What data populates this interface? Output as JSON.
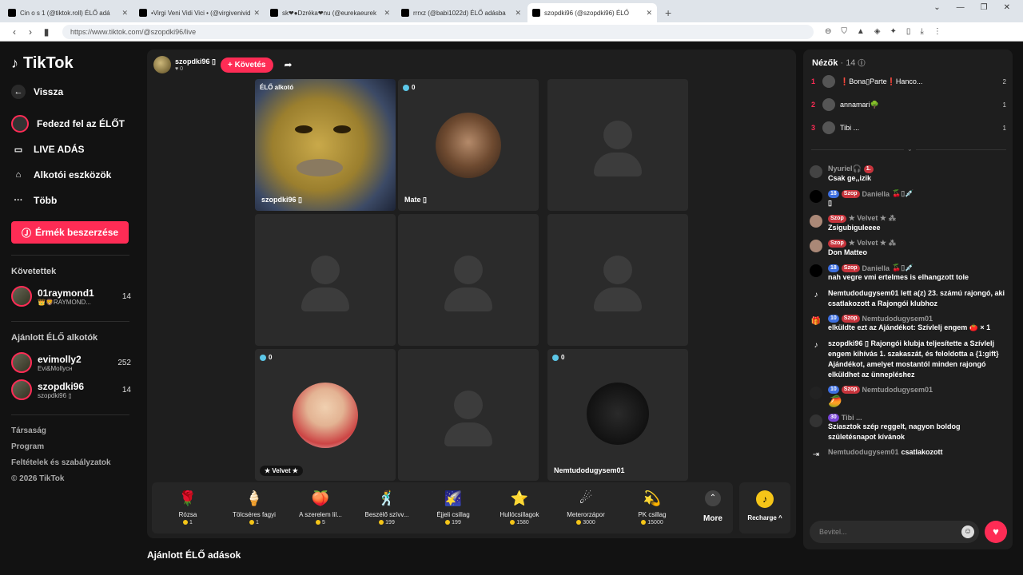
{
  "browser": {
    "tabs": [
      {
        "title": "Cin o s 1 (@tiktok.roll) ÉLŐ adá",
        "active": false
      },
      {
        "title": "•Virgi Veni Vidi Vici • (@virgivenivid",
        "active": false
      },
      {
        "title": "sk❤●Dzréka❤nu (@eurekaeurek",
        "active": false
      },
      {
        "title": "rrrxz (@babi1022d) ÉLŐ adásba",
        "active": false
      },
      {
        "title": "szopdki96 (@szopdki96) ÉLŐ",
        "active": true
      }
    ],
    "url": "https://www.tiktok.com/@szopdki96/live",
    "win_controls": [
      "⌄",
      "—",
      "❐",
      "✕"
    ]
  },
  "sidebar": {
    "brand": "TikTok",
    "back": "Vissza",
    "nav": [
      {
        "label": "Fedezd fel az ÉLŐT",
        "icon": "live-avatar-icon"
      },
      {
        "label": "LIVE ADÁS",
        "icon": "camera-icon"
      },
      {
        "label": "Alkotói eszközök",
        "icon": "home-tools-icon"
      },
      {
        "label": "Több",
        "icon": "more-dots-icon"
      }
    ],
    "coins_button": "Érmék beszerzése",
    "following_title": "Követettek",
    "following": [
      {
        "name": "01raymond1",
        "sub": "👑🦁RAYMOND...",
        "count": "14"
      }
    ],
    "suggested_title": "Ajánlott ÉLŐ alkotók",
    "suggested": [
      {
        "name": "evimolly2",
        "sub": "Evi&Mollyсн",
        "count": "252"
      },
      {
        "name": "szopdki96",
        "sub": "szopdki96 ▯",
        "count": "14"
      }
    ],
    "footer": [
      "Társaság",
      "Program",
      "Feltételek és szabályzatok",
      "© 2026 TikTok"
    ]
  },
  "live": {
    "host_name": "szopdki96 ▯",
    "host_likes": "♥ 0",
    "follow_label": "+ Követés",
    "cells": [
      {
        "label": "szopdki96 ▯",
        "badge": "ÉLŐ alkotó"
      },
      {
        "label": "Mate ▯",
        "badge": "0"
      },
      {
        "label": "",
        "badge": ""
      },
      {
        "label": "",
        "badge": ""
      },
      {
        "label": "",
        "badge": ""
      },
      {
        "label": "",
        "badge": ""
      },
      {
        "label": "★ Velvet ★",
        "badge": "0"
      },
      {
        "label": "",
        "badge": ""
      },
      {
        "label": "Nemtudodugysem01",
        "badge": "0"
      }
    ],
    "gifts": [
      {
        "name": "Rózsa",
        "price": "1",
        "icon": "🌹"
      },
      {
        "name": "Tölcséres fagyi",
        "price": "1",
        "icon": "🍦"
      },
      {
        "name": "A szerelem lil...",
        "price": "5",
        "icon": "🍑"
      },
      {
        "name": "Beszélő szívv...",
        "price": "199",
        "icon": "🕺"
      },
      {
        "name": "Éjjeli csillag",
        "price": "199",
        "icon": "🌠"
      },
      {
        "name": "Hullócsillagok",
        "price": "1580",
        "icon": "⭐"
      },
      {
        "name": "Meterorzápor",
        "price": "3000",
        "icon": "☄"
      },
      {
        "name": "PK csillag",
        "price": "15000",
        "icon": "💫"
      }
    ],
    "more_label": "More",
    "recharge_label": "Recharge ^",
    "suggested_section": "Ajánlott ÉLŐ adások"
  },
  "chat": {
    "viewers_label": "Nézők",
    "viewers_count": "· 14",
    "top_viewers": [
      {
        "rank": "1",
        "name": "❗Bona▯Parte❗Hanco...",
        "score": "2"
      },
      {
        "rank": "2",
        "name": "annamari🌳",
        "score": "1"
      },
      {
        "rank": "3",
        "name": "Tibi ...",
        "score": "1"
      }
    ],
    "messages": [
      {
        "badges": [],
        "user": "Nyuriel🎧",
        "extra": "1.",
        "text": "Csak ge,,izik"
      },
      {
        "badges": [
          "18",
          "Szop"
        ],
        "user": "Daniella",
        "extra": "🍒▯💉",
        "text": "▯"
      },
      {
        "badges": [
          "Szop"
        ],
        "user": "★ Velvet ★",
        "extra": "⁂",
        "text": "Zsigubiguleeee"
      },
      {
        "badges": [
          "Szop"
        ],
        "user": "★ Velvet ★",
        "extra": "⁂",
        "text": "Don Matteo"
      },
      {
        "badges": [
          "18",
          "Szop"
        ],
        "user": "Daniella",
        "extra": "🍒▯💉",
        "text": "nah vegre vmi ertelmes is elhangzott tole"
      },
      {
        "badges": [],
        "user": "",
        "extra": "",
        "text": "Nemtudodugysem01 lett a(z) 23. számú rajongó, aki csatlakozott a Rajongói klubhoz"
      },
      {
        "badges": [
          "10",
          "Szop"
        ],
        "user": "Nemtudodugysem01",
        "extra": "",
        "text": "elküldte ezt az Ajándékot: Szívlelj engem 🍅 × 1"
      },
      {
        "badges": [],
        "user": "",
        "extra": "",
        "text": "szopdki96 ▯ Rajongói klubja teljesítette a Szívlelj engem kihívás 1. szakaszát, és feloldotta a {1:gift} Ajándékot, amelyet mostantól minden rajongó elküldhet az ünnepléshez"
      },
      {
        "badges": [
          "10",
          "Szop"
        ],
        "user": "Nemtudodugysem01",
        "extra": "",
        "text": "🥭"
      },
      {
        "badges": [
          "30"
        ],
        "user": "Tibi ...",
        "extra": "",
        "text": "Sziasztok szép reggelt, nagyon boldog születésnapot kívánok"
      },
      {
        "badges": [],
        "user": "Nemtudodugysem01",
        "extra": "csatlakozott",
        "text": ""
      }
    ],
    "input_placeholder": "Bevitel..."
  }
}
